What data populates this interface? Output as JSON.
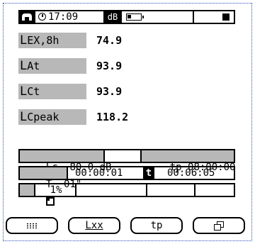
{
  "status_bar": {
    "signal_icon": "signal-wave-icon",
    "clock_icon": "clock-icon",
    "time": "17:09",
    "db_label": "dB",
    "battery_icon": "battery-icon",
    "battery_level": 0.3,
    "stop_icon": "square-stop-icon"
  },
  "readings": [
    {
      "label_main": "L",
      "label_sub": "EX,8h",
      "value": "74.9"
    },
    {
      "label_main": "L",
      "label_sub": "At",
      "value": "93.9"
    },
    {
      "label_main": "L",
      "label_sub": "Ct",
      "value": "93.9"
    },
    {
      "label_main": "L",
      "label_sub": "Cpeak",
      "value": "118.2"
    }
  ],
  "info1": {
    "lc_label": "Lc",
    "lc_value": "80.0",
    "lc_unit": "dB",
    "tp_label": "tp",
    "tp_value": "08:00:00"
  },
  "info2": {
    "t_label": "T",
    "t_value": "01\"",
    "elapsed": "00:00:01",
    "t_icon_label": "t",
    "remaining": "00:06:05"
  },
  "info3": {
    "icon": "memory-icon",
    "percent": "1%"
  },
  "buttons": {
    "menu_icon": "dotted-grid-icon",
    "lxx_label": "Lxx",
    "tp_label": "tp",
    "window_icon": "overlapping-windows-icon"
  }
}
